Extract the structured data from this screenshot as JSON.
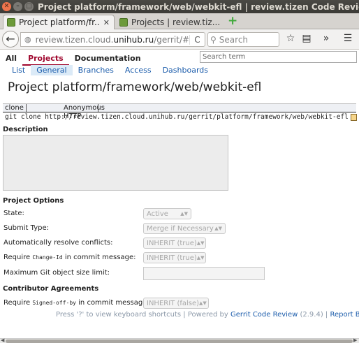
{
  "window": {
    "title": "Project platform/framework/web/webkit-efl | review.tizen Code Review - Mozilla Firefox"
  },
  "tabs": [
    {
      "label": "Project platform/fr...",
      "close": "✕"
    },
    {
      "label": "Projects | review.tiz...",
      "close": "✕"
    }
  ],
  "newtab": "+",
  "navbar": {
    "back": "←",
    "url_prefix": "review.tizen.cloud.",
    "url_domain": "unihub.ru",
    "url_suffix": "/gerrit/#",
    "reload": "C",
    "search_placeholder": "Search"
  },
  "toolbar_icons": [
    "star-icon",
    "reading-list-icon",
    "overflow-icon",
    "hamburger-menu-icon"
  ],
  "gerrit": {
    "topmenu": [
      "All",
      "Projects",
      "Documentation"
    ],
    "global_search_placeholder": "Search term",
    "submenu": [
      "List",
      "General",
      "Branches",
      "Access",
      "Dashboards"
    ],
    "project_title": "Project platform/framework/web/webkit-efl",
    "clone_label": "clone",
    "clone_method": "Anonymous HTTP",
    "clone_command": "git clone http://review.tizen.cloud.unihub.ru/gerrit/platform/framework/web/webkit-efl",
    "description_heading": "Description",
    "options_heading": "Project Options",
    "state_label": "State:",
    "state_value": "Active",
    "submit_type_label": "Submit Type:",
    "submit_type_value": "Merge if Necessary",
    "auto_resolve_label": "Automatically resolve conflicts:",
    "auto_resolve_value": "INHERIT (true)",
    "change_id_label_pre": "Require ",
    "change_id_code": "Change-Id",
    "change_id_label_post": " in commit message:",
    "change_id_value": "INHERIT (true)",
    "max_size_label": "Maximum Git object size limit:",
    "agreements_heading": "Contributor Agreements",
    "signed_off_label_pre": "Require ",
    "signed_off_code": "Signed-off-by",
    "signed_off_label_post": " in commit message:",
    "signed_off_value": "INHERIT (false)",
    "footer_shortcuts": "Press '?' to view keyboard shortcuts | Powered by ",
    "footer_gerrit_link": "Gerrit Code Review",
    "footer_version": " (2.9.4) | ",
    "footer_report_bug": "Report Bug"
  }
}
